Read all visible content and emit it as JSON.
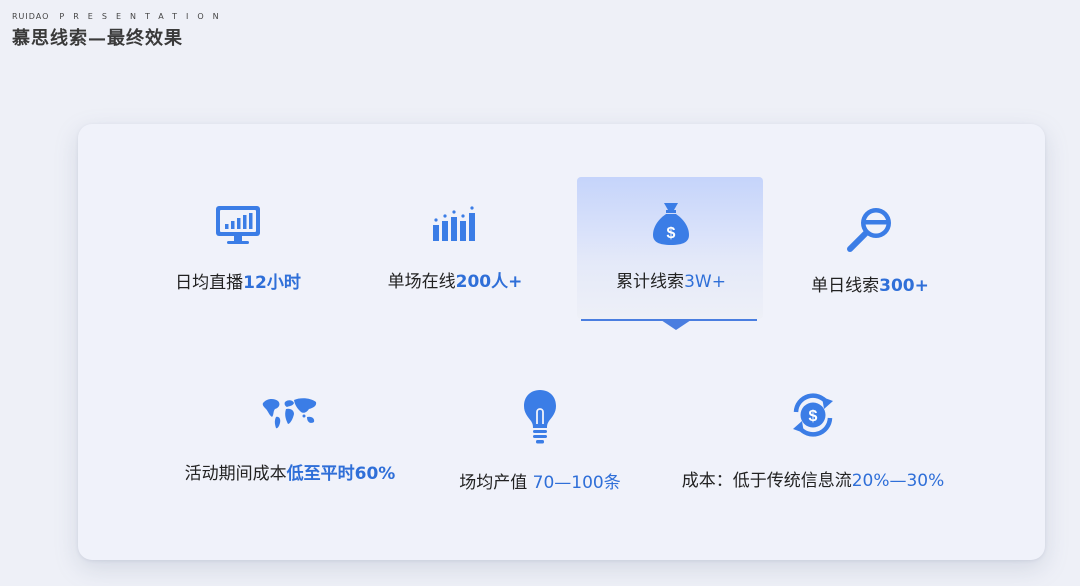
{
  "header": {
    "brand_word1": "RUIDAO",
    "brand_word2": "PRESENTATION",
    "title": "慕思线索—最终效果"
  },
  "colors": {
    "accent": "#2f6fd8",
    "icon": "#3b7de6",
    "background": "#eef0f7"
  },
  "stats_row1": [
    {
      "icon": "monitor-chart-icon",
      "prefix": "日均直播",
      "highlight": "12小时"
    },
    {
      "icon": "bar-chart-icon",
      "prefix": "单场在线",
      "highlight": "200人+"
    },
    {
      "icon": "money-bag-icon",
      "prefix": "累计线索",
      "highlight": "3W+",
      "selected": true
    },
    {
      "icon": "magnifier-icon",
      "prefix": "单日线索",
      "highlight": "300+"
    }
  ],
  "stats_row2": [
    {
      "icon": "world-map-icon",
      "prefix": "活动期间成本",
      "highlight": "低至平时60%"
    },
    {
      "icon": "lightbulb-icon",
      "prefix": "场均产值 ",
      "highlight": "70—100条"
    },
    {
      "icon": "dollar-cycle-icon",
      "prefix": "成本：低于传统信息流",
      "highlight": "20%—30%"
    }
  ]
}
